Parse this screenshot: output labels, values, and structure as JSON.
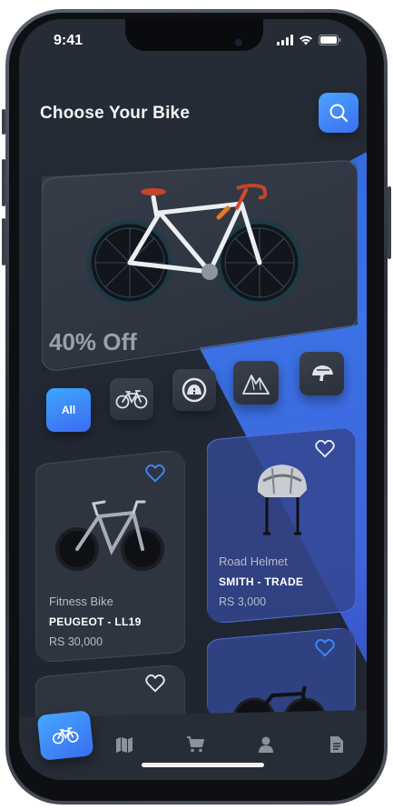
{
  "status": {
    "time": "9:41"
  },
  "header": {
    "title": "Choose Your Bike"
  },
  "hero": {
    "discount": "40% Off"
  },
  "categories": [
    {
      "label": "All",
      "icon": "all-text",
      "selected": true
    },
    {
      "icon": "bicycle-icon"
    },
    {
      "icon": "road-icon"
    },
    {
      "icon": "mountain-icon"
    },
    {
      "icon": "helmet-icon"
    }
  ],
  "products": [
    {
      "category": "Fitness Bike",
      "name": "PEUGEOT - LL19",
      "price": "RS 30,000"
    },
    {
      "category": "Road Helmet",
      "name": "SMITH - TRADE",
      "price": "RS 3,000"
    }
  ],
  "nav": {
    "items": [
      "bicycle-icon",
      "map-icon",
      "cart-icon",
      "user-icon",
      "document-icon"
    ]
  },
  "colors": {
    "accent": "#3d7af0",
    "background": "#242a34",
    "card": "#2c333e"
  }
}
